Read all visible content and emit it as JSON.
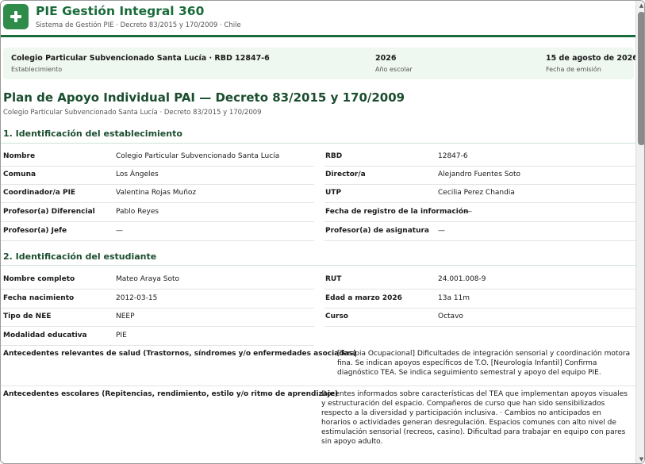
{
  "app": {
    "title": "PIE Gestión Integral 360",
    "subtitle": "Sistema de Gestión PIE · Decreto 83/2015 y 170/2009 · Chile",
    "logo_icon": "plus-icon",
    "accent": "#1a6b3a"
  },
  "infobar": {
    "school": {
      "value": "Colegio Particular Subvencionado Santa Lucía · RBD 12847-6",
      "label": "Establecimiento"
    },
    "year": {
      "value": "2026",
      "label": "Año escolar"
    },
    "date": {
      "value": "15 de agosto de 2026",
      "label": "Fecha de emisión"
    }
  },
  "document": {
    "title": "Plan de Apoyo Individual PAI — Decreto 83/2015 y 170/2009",
    "subtitle": "Colegio Particular Subvencionado Santa Lucía · Decreto 83/2015 y 170/2009"
  },
  "section1": {
    "heading": "1. Identificación del establecimiento",
    "rows": [
      {
        "l1": "Nombre",
        "v1": "Colegio Particular Subvencionado Santa Lucía",
        "l2": "RBD",
        "v2": "12847-6"
      },
      {
        "l1": "Comuna",
        "v1": "Los Ángeles",
        "l2": "Director/a",
        "v2": "Alejandro Fuentes Soto"
      },
      {
        "l1": "Coordinador/a PIE",
        "v1": "Valentina Rojas Muñoz",
        "l2": "UTP",
        "v2": "Cecilia Perez Chandia"
      },
      {
        "l1": "Profesor(a) Diferencial",
        "v1": "Pablo Reyes",
        "l2": "Fecha de registro de la información",
        "v2": "—"
      },
      {
        "l1": "Profesor(a) Jefe",
        "v1": "—",
        "l2": "Profesor(a) de asignatura",
        "v2": "—"
      }
    ]
  },
  "section2": {
    "heading": "2. Identificación del estudiante",
    "rows": [
      {
        "l1": "Nombre completo",
        "v1": "Mateo Araya Soto",
        "l2": "RUT",
        "v2": "24.001.008-9"
      },
      {
        "l1": "Fecha nacimiento",
        "v1": "2012-03-15",
        "l2": "Edad a marzo 2026",
        "v2": "13a 11m"
      },
      {
        "l1": "Tipo de NEE",
        "v1": "NEEP",
        "l2": "Curso",
        "v2": "Octavo"
      },
      {
        "l1": "Modalidad educativa",
        "v1": "PIE",
        "l2": "",
        "v2": ""
      }
    ],
    "health": {
      "label": "Antecedentes relevantes de salud (Trastornos, síndromes y/o enfermedades asociadas)",
      "value": "[Terapia Ocupacional] Dificultades de integración sensorial y coordinación motora fina. Se indican apoyos específicos de T.O. [Neurología Infantil] Confirma diagnóstico TEA. Se indica seguimiento semestral y apoyo del equipo PIE."
    },
    "school": {
      "label": "Antecedentes escolares (Repitencias, rendimiento, estilo y/o ritmo de aprendizaje)",
      "value": "Docentes informados sobre características del TEA que implementan apoyos visuales y estructuración del espacio. Compañeros de curso que han sido sensibilizados respecto a la diversidad y participación inclusiva. · Cambios no anticipados en horarios o actividades generan desregulación. Espacios comunes con alto nivel de estimulación sensorial (recreos, casino). Dificultad para trabajar en equipo con pares sin apoyo adulto."
    }
  }
}
